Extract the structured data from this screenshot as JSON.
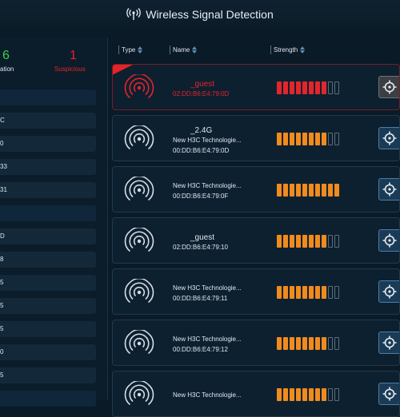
{
  "header": {
    "title": "Wireless Signal Detection",
    "icon": "wifi-broadcast-icon"
  },
  "stats": {
    "good_count": "6",
    "good_label": "ation",
    "suspicious_count": "1",
    "suspicious_label": "Suspicious"
  },
  "left_list": [
    "",
    "C",
    "0",
    "33",
    "31",
    "",
    "D",
    "8",
    "5",
    "5",
    "5",
    "0",
    "5",
    ""
  ],
  "columns": {
    "type": "Type",
    "name": "Name",
    "strength": "Strength"
  },
  "networks": [
    {
      "lines": [
        "_guest",
        "02:DD:B6:E4:79:0D"
      ],
      "strength": 8,
      "suspicious": true
    },
    {
      "lines": [
        "_2.4G",
        "New H3C Technologie...",
        "00:DD:B6:E4:79:0D"
      ],
      "strength": 8,
      "suspicious": false
    },
    {
      "lines": [
        "New H3C Technologie...",
        "00:DD:B6:E4:79:0F"
      ],
      "strength": 10,
      "suspicious": false
    },
    {
      "lines": [
        "_guest",
        "02:DD:B6:E4:79:10"
      ],
      "strength": 8,
      "suspicious": false
    },
    {
      "lines": [
        "New H3C Technologie...",
        "00:DD:B6:E4:79:11"
      ],
      "strength": 8,
      "suspicious": false
    },
    {
      "lines": [
        "New H3C Technologie...",
        "00:DD:B6:E4:79:12"
      ],
      "strength": 8,
      "suspicious": false
    },
    {
      "lines": [
        "New H3C Technologie..."
      ],
      "strength": 8,
      "suspicious": false
    }
  ],
  "colors": {
    "suspicious": "#e3242b",
    "good": "#3ed14a",
    "bar_red": "#e3262c",
    "bar_orange": "#f08b1d"
  }
}
